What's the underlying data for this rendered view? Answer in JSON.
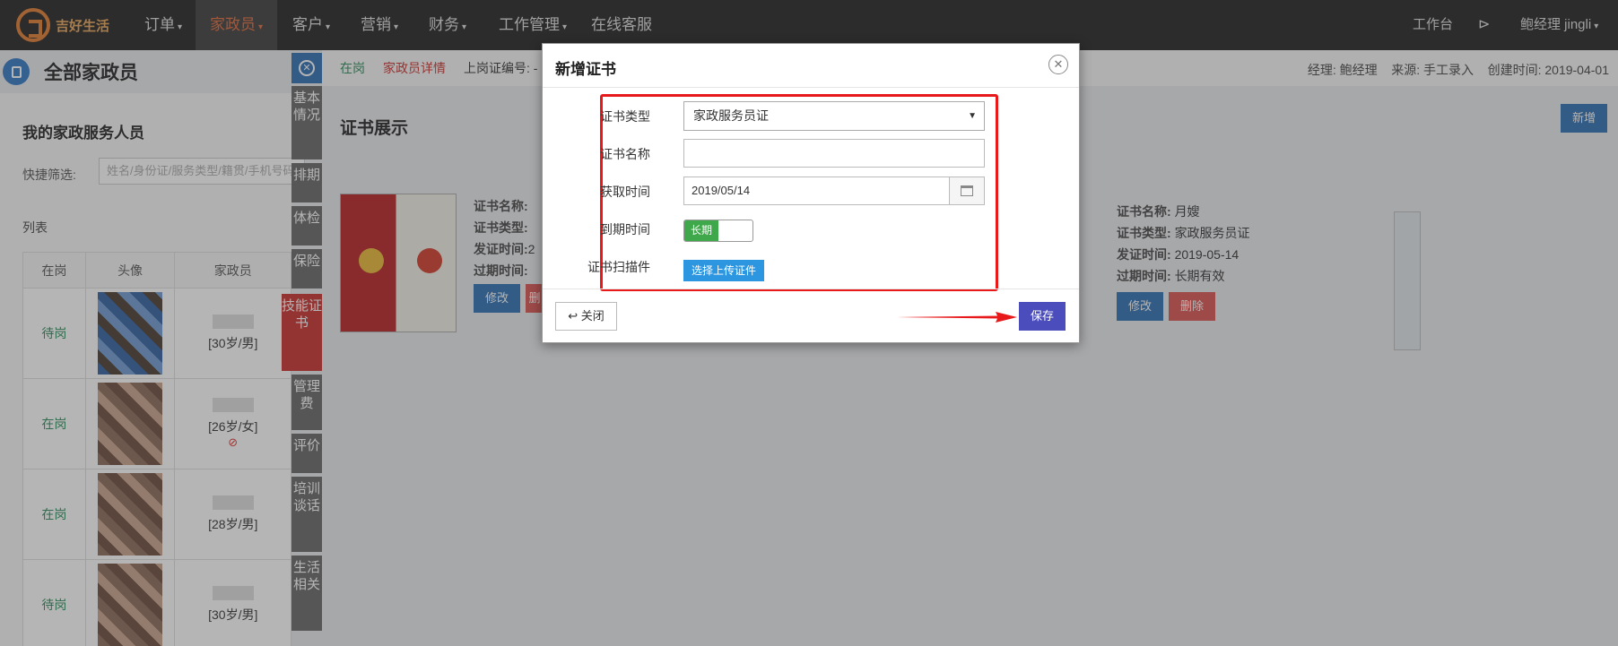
{
  "topnav": {
    "brand": "吉好生活",
    "items": [
      {
        "label": "订单",
        "caret": true
      },
      {
        "label": "家政员",
        "caret": true,
        "active": true
      },
      {
        "label": "客户",
        "caret": true
      },
      {
        "label": "营销",
        "caret": true
      },
      {
        "label": "财务",
        "caret": true
      },
      {
        "label": "工作管理",
        "caret": true
      },
      {
        "label": "在线客服",
        "caret": false
      }
    ],
    "workbench": "工作台",
    "user": "鲍经理 jingli"
  },
  "left": {
    "page_title": "全部家政员",
    "section_title": "我的家政服务人员",
    "filter_label": "快捷筛选:",
    "filter_placeholder": "姓名/身份证/服务类型/籍贯/手机号码",
    "list_label": "列表",
    "table_headers": [
      "在岗",
      "头像",
      "家政员"
    ],
    "rows": [
      {
        "status": "待岗",
        "age_gender": "[30岁/男]",
        "forbidden": false
      },
      {
        "status": "在岗",
        "age_gender": "[26岁/女]",
        "forbidden": true
      },
      {
        "status": "在岗",
        "age_gender": "[28岁/男]",
        "forbidden": false
      },
      {
        "status": "待岗",
        "age_gender": "[30岁/男]",
        "forbidden": false
      }
    ]
  },
  "vtabs": [
    "基本情况",
    "排期",
    "体检",
    "保险",
    "技能证书",
    "管理费",
    "评价",
    "培训谈话",
    "生活相关"
  ],
  "vtabs_active": "技能证书",
  "info_bar": {
    "status": "在岗",
    "detail_link": "家政员详情",
    "badge_label": "上岗证编号: -",
    "manager": "经理: 鲍经理",
    "source": "来源: 手工录入",
    "created": "创建时间: 2019-04-01"
  },
  "cert_section": {
    "title": "证书展示",
    "new_button": "新增",
    "card1": {
      "labels": [
        "证书名称:",
        "证书类型:",
        "发证时间:",
        "过期时间:"
      ],
      "values": [
        "",
        "",
        "2",
        ""
      ],
      "edit": "修改",
      "delete": "删除"
    },
    "card2": {
      "labels": [
        "证书名称:",
        "证书类型:",
        "发证时间:",
        "过期时间:"
      ],
      "values": [
        "月嫂",
        "家政服务员证",
        "2019-05-14",
        "长期有效"
      ],
      "edit": "修改",
      "delete": "删除"
    }
  },
  "modal": {
    "title": "新增证书",
    "fields": {
      "type_label": "证书类型",
      "type_value": "家政服务员证",
      "name_label": "证书名称",
      "name_value": "",
      "obtain_label": "获取时间",
      "obtain_value": "2019/05/14",
      "expire_label": "到期时间",
      "expire_toggle": "长期",
      "scan_label": "证书扫描件",
      "upload_button": "选择上传证件"
    },
    "close_button": "关闭",
    "save_button": "保存"
  },
  "colors": {
    "nav_bg": "#232323",
    "accent_red": "#e8191a",
    "primary_blue": "#2d6fb4",
    "save_blue": "#4a4dbb",
    "toggle_green": "#3fa84a"
  }
}
